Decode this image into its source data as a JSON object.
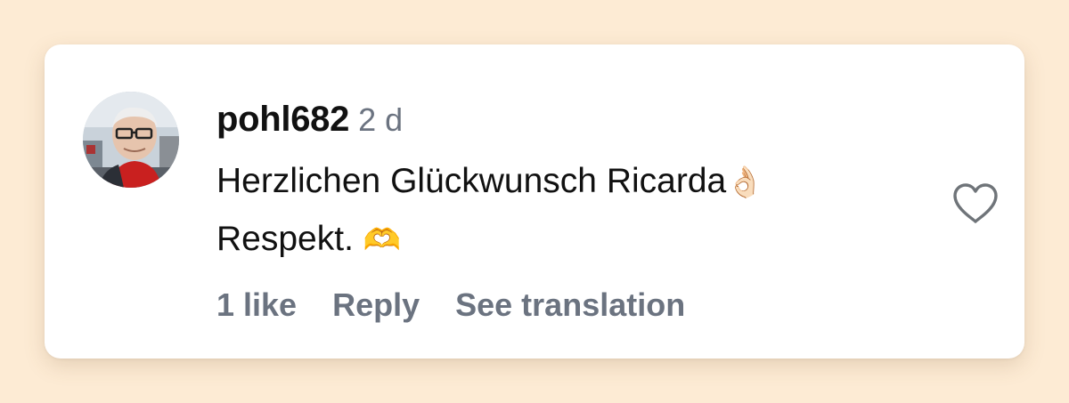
{
  "comment": {
    "username": "pohl682",
    "timestamp": "2 d",
    "text_line_1": "Herzlichen Glückwunsch Ricarda",
    "emoji_1": "👌🏻",
    "text_line_2": "Respekt. ",
    "emoji_2": "🫶",
    "likes_label": "1 like",
    "reply_label": "Reply",
    "translate_label": "See translation"
  },
  "icons": {
    "avatar": "user-avatar",
    "like": "heart-outline-icon"
  },
  "colors": {
    "background": "#fdebd4",
    "card": "#ffffff",
    "text_primary": "#111111",
    "text_secondary": "#6b7380"
  }
}
